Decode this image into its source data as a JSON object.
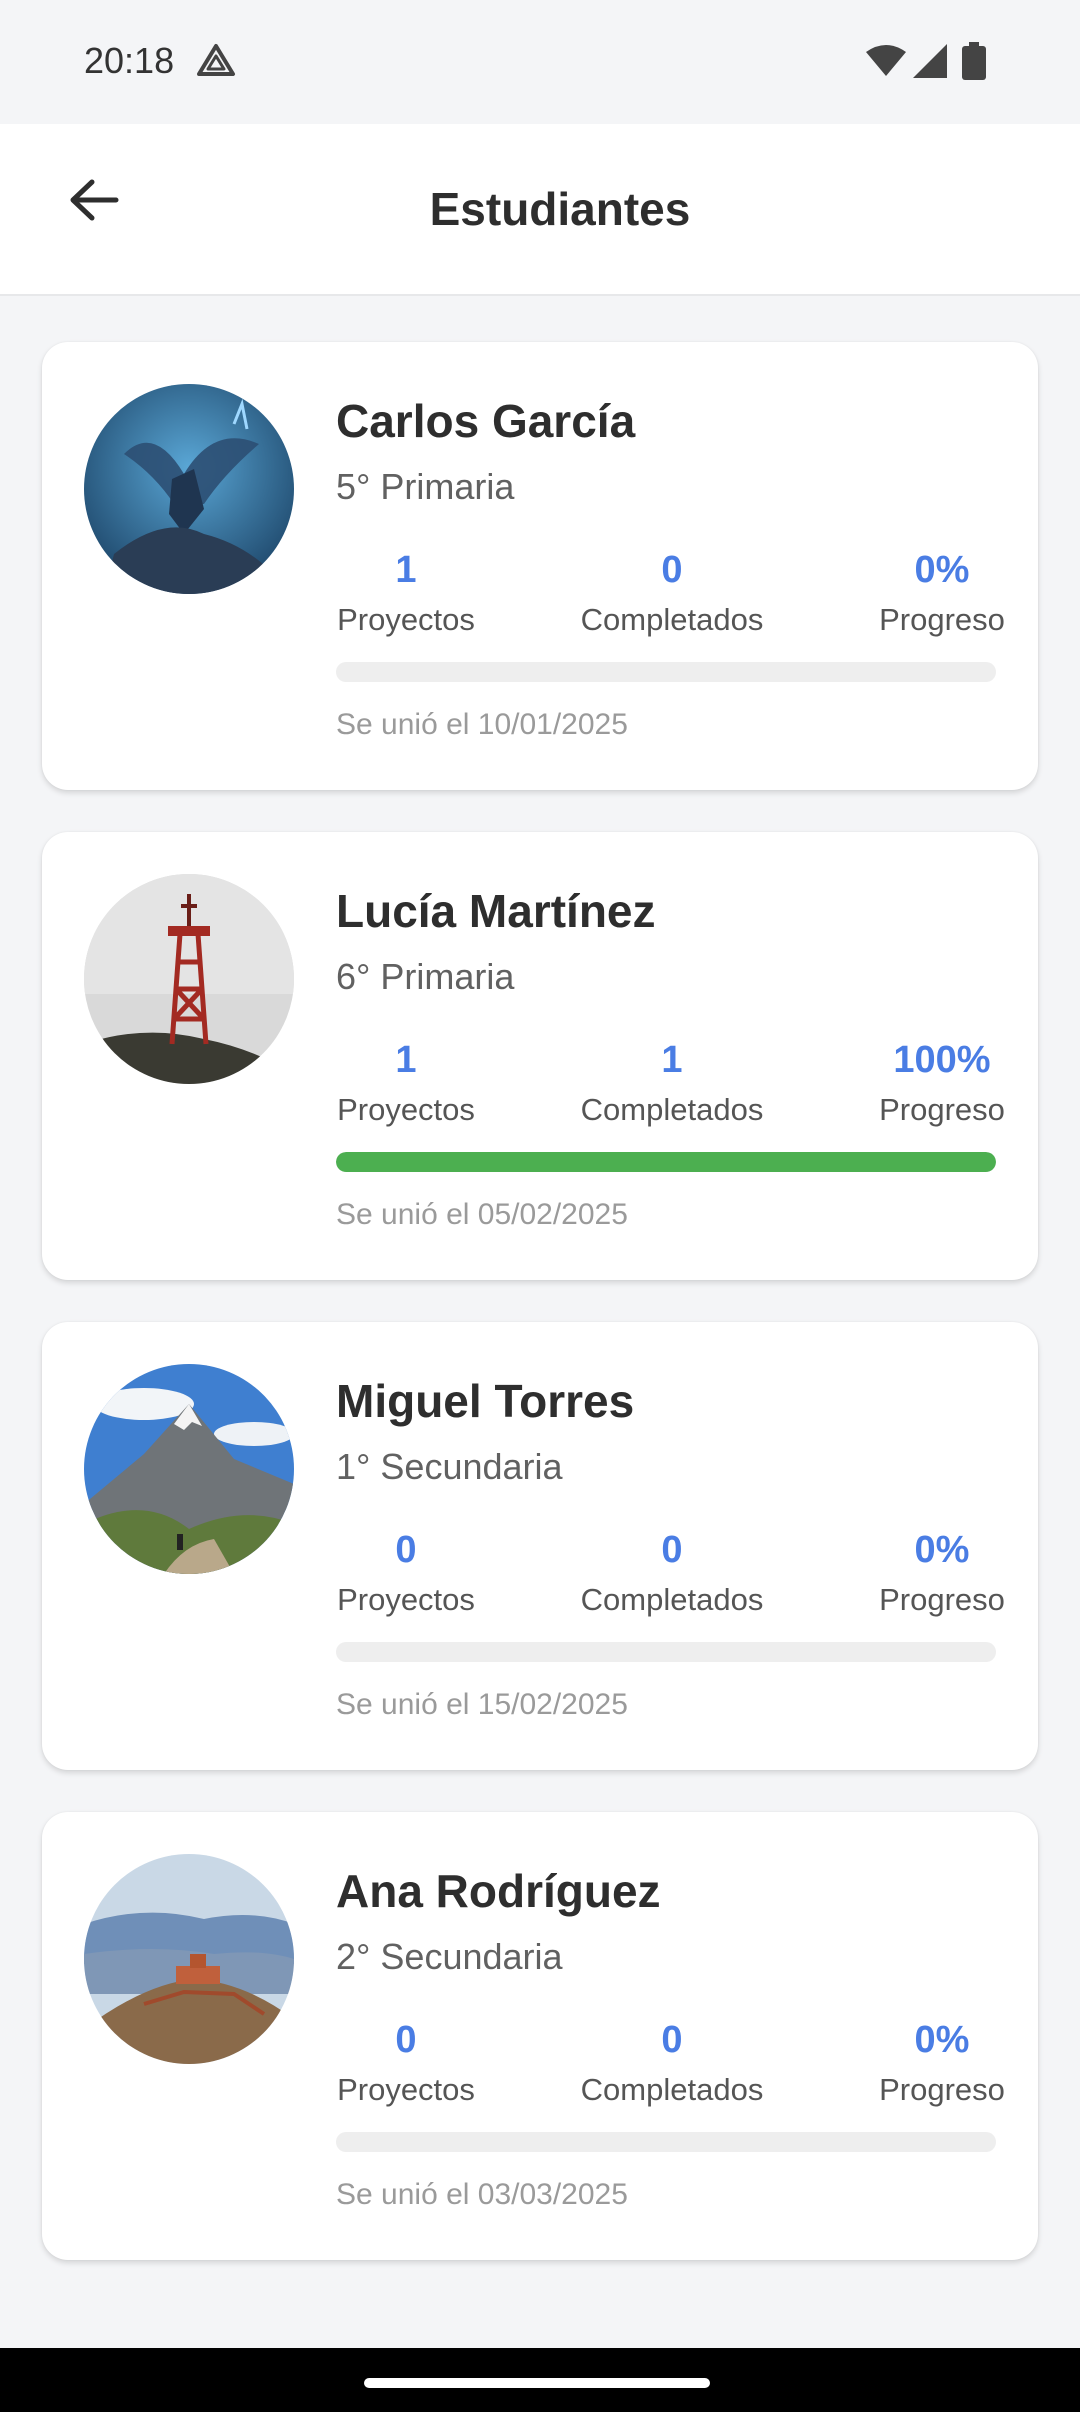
{
  "status": {
    "time": "20:18"
  },
  "header": {
    "title": "Estudiantes"
  },
  "students": [
    {
      "name": "Carlos García",
      "grade": "5° Primaria",
      "projects": "1",
      "projects_label": "Proyectos",
      "completed": "0",
      "completed_label": "Completados",
      "progress": "0%",
      "progress_label": "Progreso",
      "progress_value": 0,
      "joined": "Se unió el 10/01/2025"
    },
    {
      "name": "Lucía Martínez",
      "grade": "6° Primaria",
      "projects": "1",
      "projects_label": "Proyectos",
      "completed": "1",
      "completed_label": "Completados",
      "progress": "100%",
      "progress_label": "Progreso",
      "progress_value": 100,
      "joined": "Se unió el 05/02/2025"
    },
    {
      "name": "Miguel Torres",
      "grade": "1° Secundaria",
      "projects": "0",
      "projects_label": "Proyectos",
      "completed": "0",
      "completed_label": "Completados",
      "progress": "0%",
      "progress_label": "Progreso",
      "progress_value": 0,
      "joined": "Se unió el 15/02/2025"
    },
    {
      "name": "Ana Rodríguez",
      "grade": "2° Secundaria",
      "projects": "0",
      "projects_label": "Proyectos",
      "completed": "0",
      "completed_label": "Completados",
      "progress": "0%",
      "progress_label": "Progreso",
      "progress_value": 0,
      "joined": "Se unió el 03/03/2025"
    }
  ],
  "colors": {
    "accent": "#4a7de4",
    "progress_fill": "#4caf50"
  },
  "icons": {
    "back": "arrow-left-icon"
  }
}
